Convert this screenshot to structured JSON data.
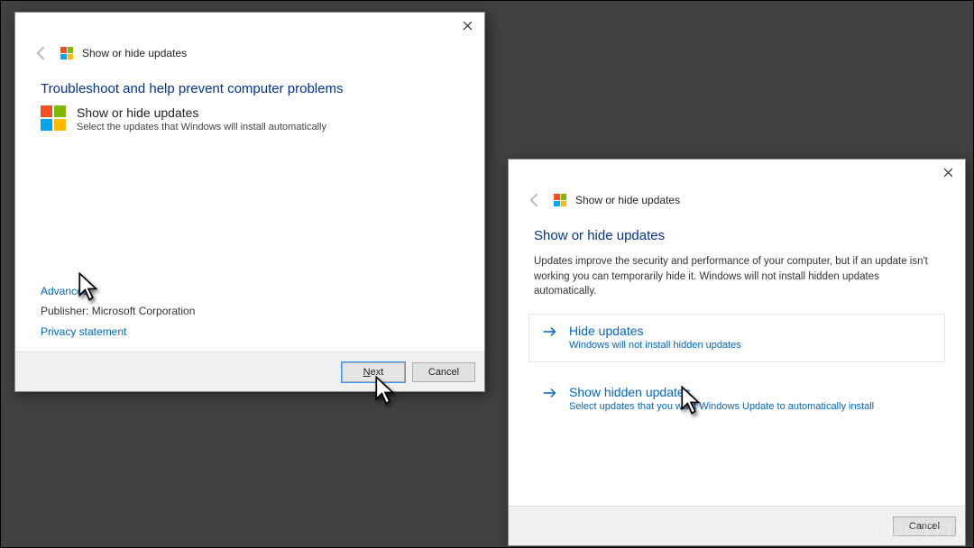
{
  "watermark": "UG⟳TFIX",
  "dialog1": {
    "window_title": "Show or hide updates",
    "heading": "Troubleshoot and help prevent computer problems",
    "logo_title": "Show or hide updates",
    "logo_sub": "Select the updates that Windows will install automatically",
    "advanced_link": "Advanced",
    "publisher_label": "Publisher: Microsoft Corporation",
    "privacy_link": "Privacy statement",
    "next_label": "Next",
    "cancel_label": "Cancel"
  },
  "dialog2": {
    "window_title": "Show or hide updates",
    "heading": "Show or hide updates",
    "description": "Updates improve the security and performance of your computer, but if an update isn't working you can temporarily hide it. Windows will not install hidden updates automatically.",
    "options": [
      {
        "title": "Hide updates",
        "desc": "Windows will not install hidden updates"
      },
      {
        "title": "Show hidden updates",
        "desc": "Select updates that you want Windows Update to automatically install"
      }
    ],
    "cancel_label": "Cancel"
  }
}
